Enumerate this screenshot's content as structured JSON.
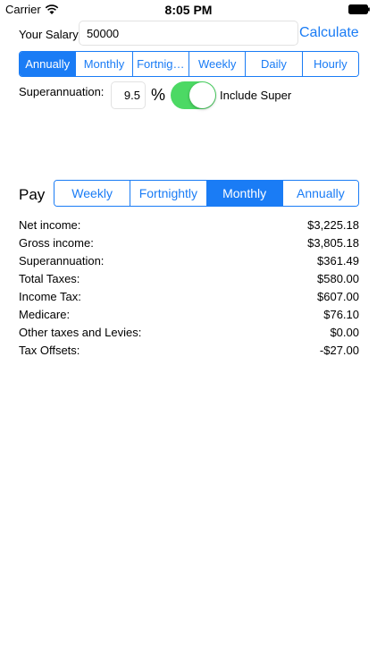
{
  "status_bar": {
    "carrier": "Carrier",
    "time": "8:05 PM",
    "wifi_icon": "wifi-icon",
    "battery_icon": "battery-icon"
  },
  "salary": {
    "label": "Your Salary:",
    "value": "50000",
    "calculate_label": "Calculate"
  },
  "period_segments": {
    "options": [
      "Annually",
      "Monthly",
      "Fortnig…",
      "Weekly",
      "Daily",
      "Hourly"
    ],
    "selected_index": 0
  },
  "superannuation": {
    "label": "Superannuation:",
    "rate": "9.5",
    "percent_symbol": "%",
    "include_enabled": true,
    "include_label": "Include Super"
  },
  "pay": {
    "label": "Pay",
    "options": [
      "Weekly",
      "Fortnightly",
      "Monthly",
      "Annually"
    ],
    "selected_index": 2
  },
  "results": [
    {
      "label": "Net income:",
      "value": "$3,225.18"
    },
    {
      "label": "Gross income:",
      "value": "$3,805.18"
    },
    {
      "label": "Superannuation:",
      "value": "$361.49"
    },
    {
      "label": "Total Taxes:",
      "value": "$580.00"
    },
    {
      "label": "Income Tax:",
      "value": "$607.00"
    },
    {
      "label": "Medicare:",
      "value": "$76.10"
    },
    {
      "label": "Other taxes and Levies:",
      "value": "$0.00"
    },
    {
      "label": "Tax Offsets:",
      "value": "-$27.00"
    }
  ],
  "colors": {
    "accent": "#1a7cf5",
    "toggle_on": "#4cd964"
  }
}
